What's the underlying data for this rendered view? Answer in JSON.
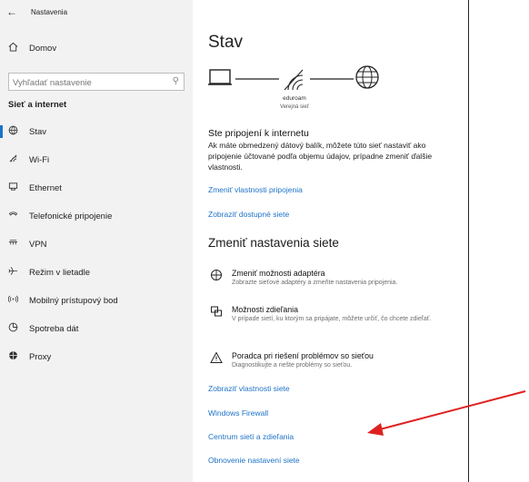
{
  "window": {
    "title": "Nastavenia"
  },
  "sidebar": {
    "home_label": "Domov",
    "search_placeholder": "Vyhľadať nastavenie",
    "group_label": "Sieť a internet",
    "items": [
      {
        "label": "Stav",
        "icon": "globe-icon",
        "active": true
      },
      {
        "label": "Wi-Fi",
        "icon": "wifi-icon"
      },
      {
        "label": "Ethernet",
        "icon": "ethernet-icon"
      },
      {
        "label": "Telefonické pripojenie",
        "icon": "dialup-icon"
      },
      {
        "label": "VPN",
        "icon": "vpn-icon"
      },
      {
        "label": "Režim v lietadle",
        "icon": "airplane-icon"
      },
      {
        "label": "Mobilný prístupový bod",
        "icon": "hotspot-icon"
      },
      {
        "label": "Spotreba dát",
        "icon": "data-usage-icon"
      },
      {
        "label": "Proxy",
        "icon": "proxy-globe-icon"
      }
    ]
  },
  "main": {
    "title": "Stav",
    "network": {
      "name": "eduroam",
      "type": "Verejná sieť"
    },
    "connected_heading": "Ste pripojení k internetu",
    "connected_text": "Ak máte obmedzený dátový balík, môžete túto sieť nastaviť ako pripojenie účtované podľa objemu údajov, prípadne zmeniť ďalšie vlastnosti.",
    "link_change_props": "Zmeniť vlastnosti pripojenia",
    "link_show_networks": "Zobraziť dostupné siete",
    "section_heading": "Zmeniť nastavenia siete",
    "options": [
      {
        "title": "Zmeniť možnosti adaptéra",
        "desc": "Zobrazte sieťové adaptéry a zmeňte nastavenia pripojenia."
      },
      {
        "title": "Možnosti zdieľania",
        "desc": "V prípade sietí, ku ktorým sa pripájate, môžete určiť, čo chcete zdieľať."
      },
      {
        "title": "Poradca pri riešení problémov so sieťou",
        "desc": "Diagnostikujte a riešte problémy so sieťou."
      }
    ],
    "links": [
      "Zobraziť vlastnosti siete",
      "Windows Firewall",
      "Centrum sietí a zdieľania",
      "Obnovenie nastavení siete"
    ]
  },
  "annotation": {
    "color": "#e02020"
  }
}
